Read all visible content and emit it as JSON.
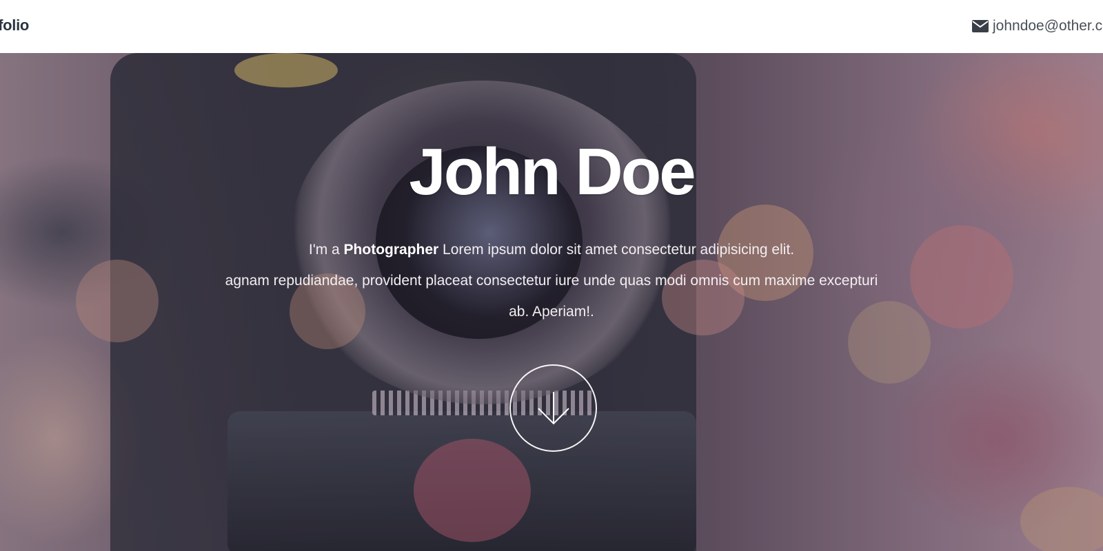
{
  "navbar": {
    "brand": "rtifolio",
    "contact": {
      "icon": "envelope-icon",
      "email": "johndoe@other.c"
    }
  },
  "hero": {
    "title": "John Doe",
    "description": {
      "prefix": "I'm a ",
      "role": "Photographer",
      "line1_rest": " Lorem ipsum dolor sit amet consectetur adipisicing elit.",
      "line2": "agnam repudiandae, provident placeat consectetur iure unde quas modi omnis cum maxime excepturi",
      "line3": "ab. Aperiam!."
    },
    "scroll_button": {
      "icon": "arrow-down-icon"
    }
  },
  "colors": {
    "navbar_bg": "#ffffff",
    "brand_text": "#2b3440",
    "hero_text": "#ffffff"
  }
}
